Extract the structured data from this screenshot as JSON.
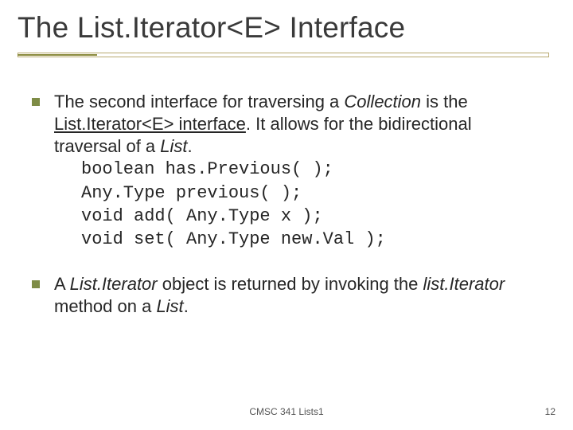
{
  "title": "The List.Iterator<E> Interface",
  "bullet1": {
    "pre": "The second interface for traversing a ",
    "collection": "Collection",
    "mid1": " is the ",
    "listiter": "List.Iterator<E> interface",
    "mid2": ".  It allows for the bidirectional traversal of a ",
    "list": "List",
    "post": "."
  },
  "code": {
    "l1": "boolean has.Previous( );",
    "l2": "Any.Type previous( );",
    "l3": "void add( Any.Type x );",
    "l4": "void set( Any.Type new.Val );"
  },
  "bullet2": {
    "pre": "A ",
    "listiterator": "List.Iterator",
    "mid1": " object is returned by invoking the ",
    "method": "list.Iterator",
    "mid2": " method on a ",
    "list": "List",
    "post": "."
  },
  "footer": {
    "center": "CMSC 341 Lists1",
    "page": "12"
  }
}
